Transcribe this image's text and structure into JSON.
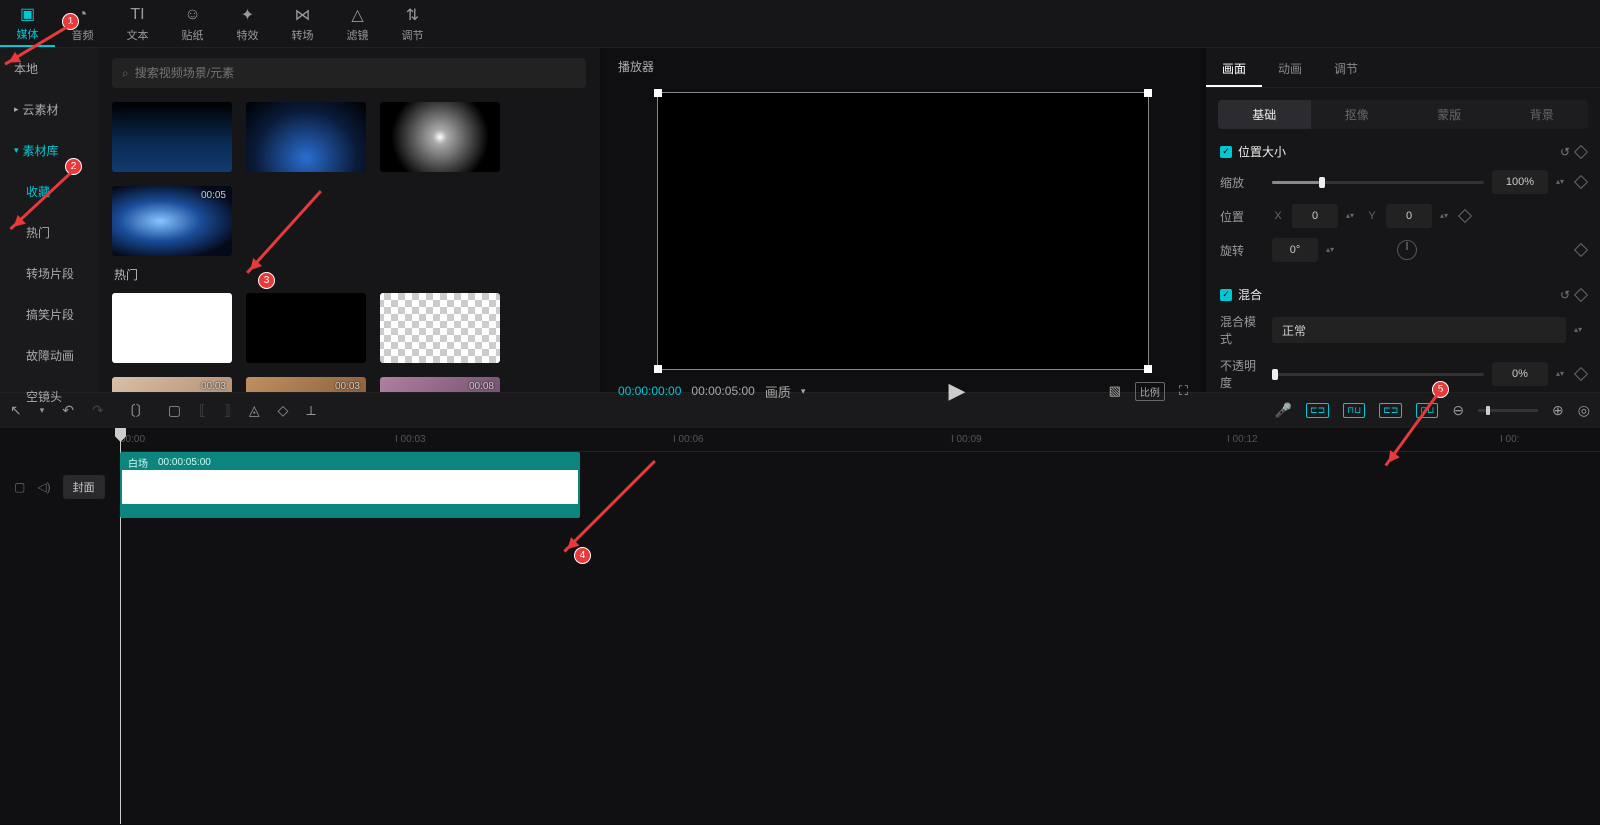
{
  "toolbar": [
    {
      "label": "媒体",
      "icon": "▣"
    },
    {
      "label": "音频",
      "icon": "◔"
    },
    {
      "label": "文本",
      "icon": "TI"
    },
    {
      "label": "贴纸",
      "icon": "☺"
    },
    {
      "label": "特效",
      "icon": "✦"
    },
    {
      "label": "转场",
      "icon": "⋈"
    },
    {
      "label": "滤镜",
      "icon": "△"
    },
    {
      "label": "调节",
      "icon": "⇅"
    }
  ],
  "sidebar": {
    "items": [
      "本地",
      "云素材",
      "素材库"
    ],
    "subs": [
      "收藏",
      "热门",
      "转场片段",
      "搞笑片段",
      "故障动画",
      "空镜头"
    ]
  },
  "search": {
    "placeholder": "搜索视频场景/元素"
  },
  "thumbs_top_dur": "00:05",
  "section_hot": "热门",
  "hot_durs": [
    "00:03",
    "00:03",
    "00:08"
  ],
  "player": {
    "title": "播放器",
    "current": "00:00:00:00",
    "total": "00:00:05:00",
    "quality": "画质"
  },
  "props": {
    "tabs": [
      "画面",
      "动画",
      "调节"
    ],
    "subtabs": [
      "基础",
      "抠像",
      "蒙版",
      "背景"
    ],
    "pos_size": "位置大小",
    "scale": "缩放",
    "scale_val": "100%",
    "position": "位置",
    "x": "X",
    "x_val": "0",
    "y": "Y",
    "y_val": "0",
    "rotation": "旋转",
    "rot_val": "0°",
    "blend": "混合",
    "blend_mode": "混合模式",
    "blend_val": "正常",
    "opacity": "不透明度",
    "opacity_val": "0%"
  },
  "ruler": [
    "00:00",
    "I 00:03",
    "I 00:06",
    "I 00:09",
    "I 00:12",
    "I 00:"
  ],
  "clip": {
    "name": "白场",
    "dur": "00:00:05:00"
  },
  "cover": "封面",
  "annotations": [
    "1",
    "2",
    "3",
    "4",
    "5"
  ]
}
